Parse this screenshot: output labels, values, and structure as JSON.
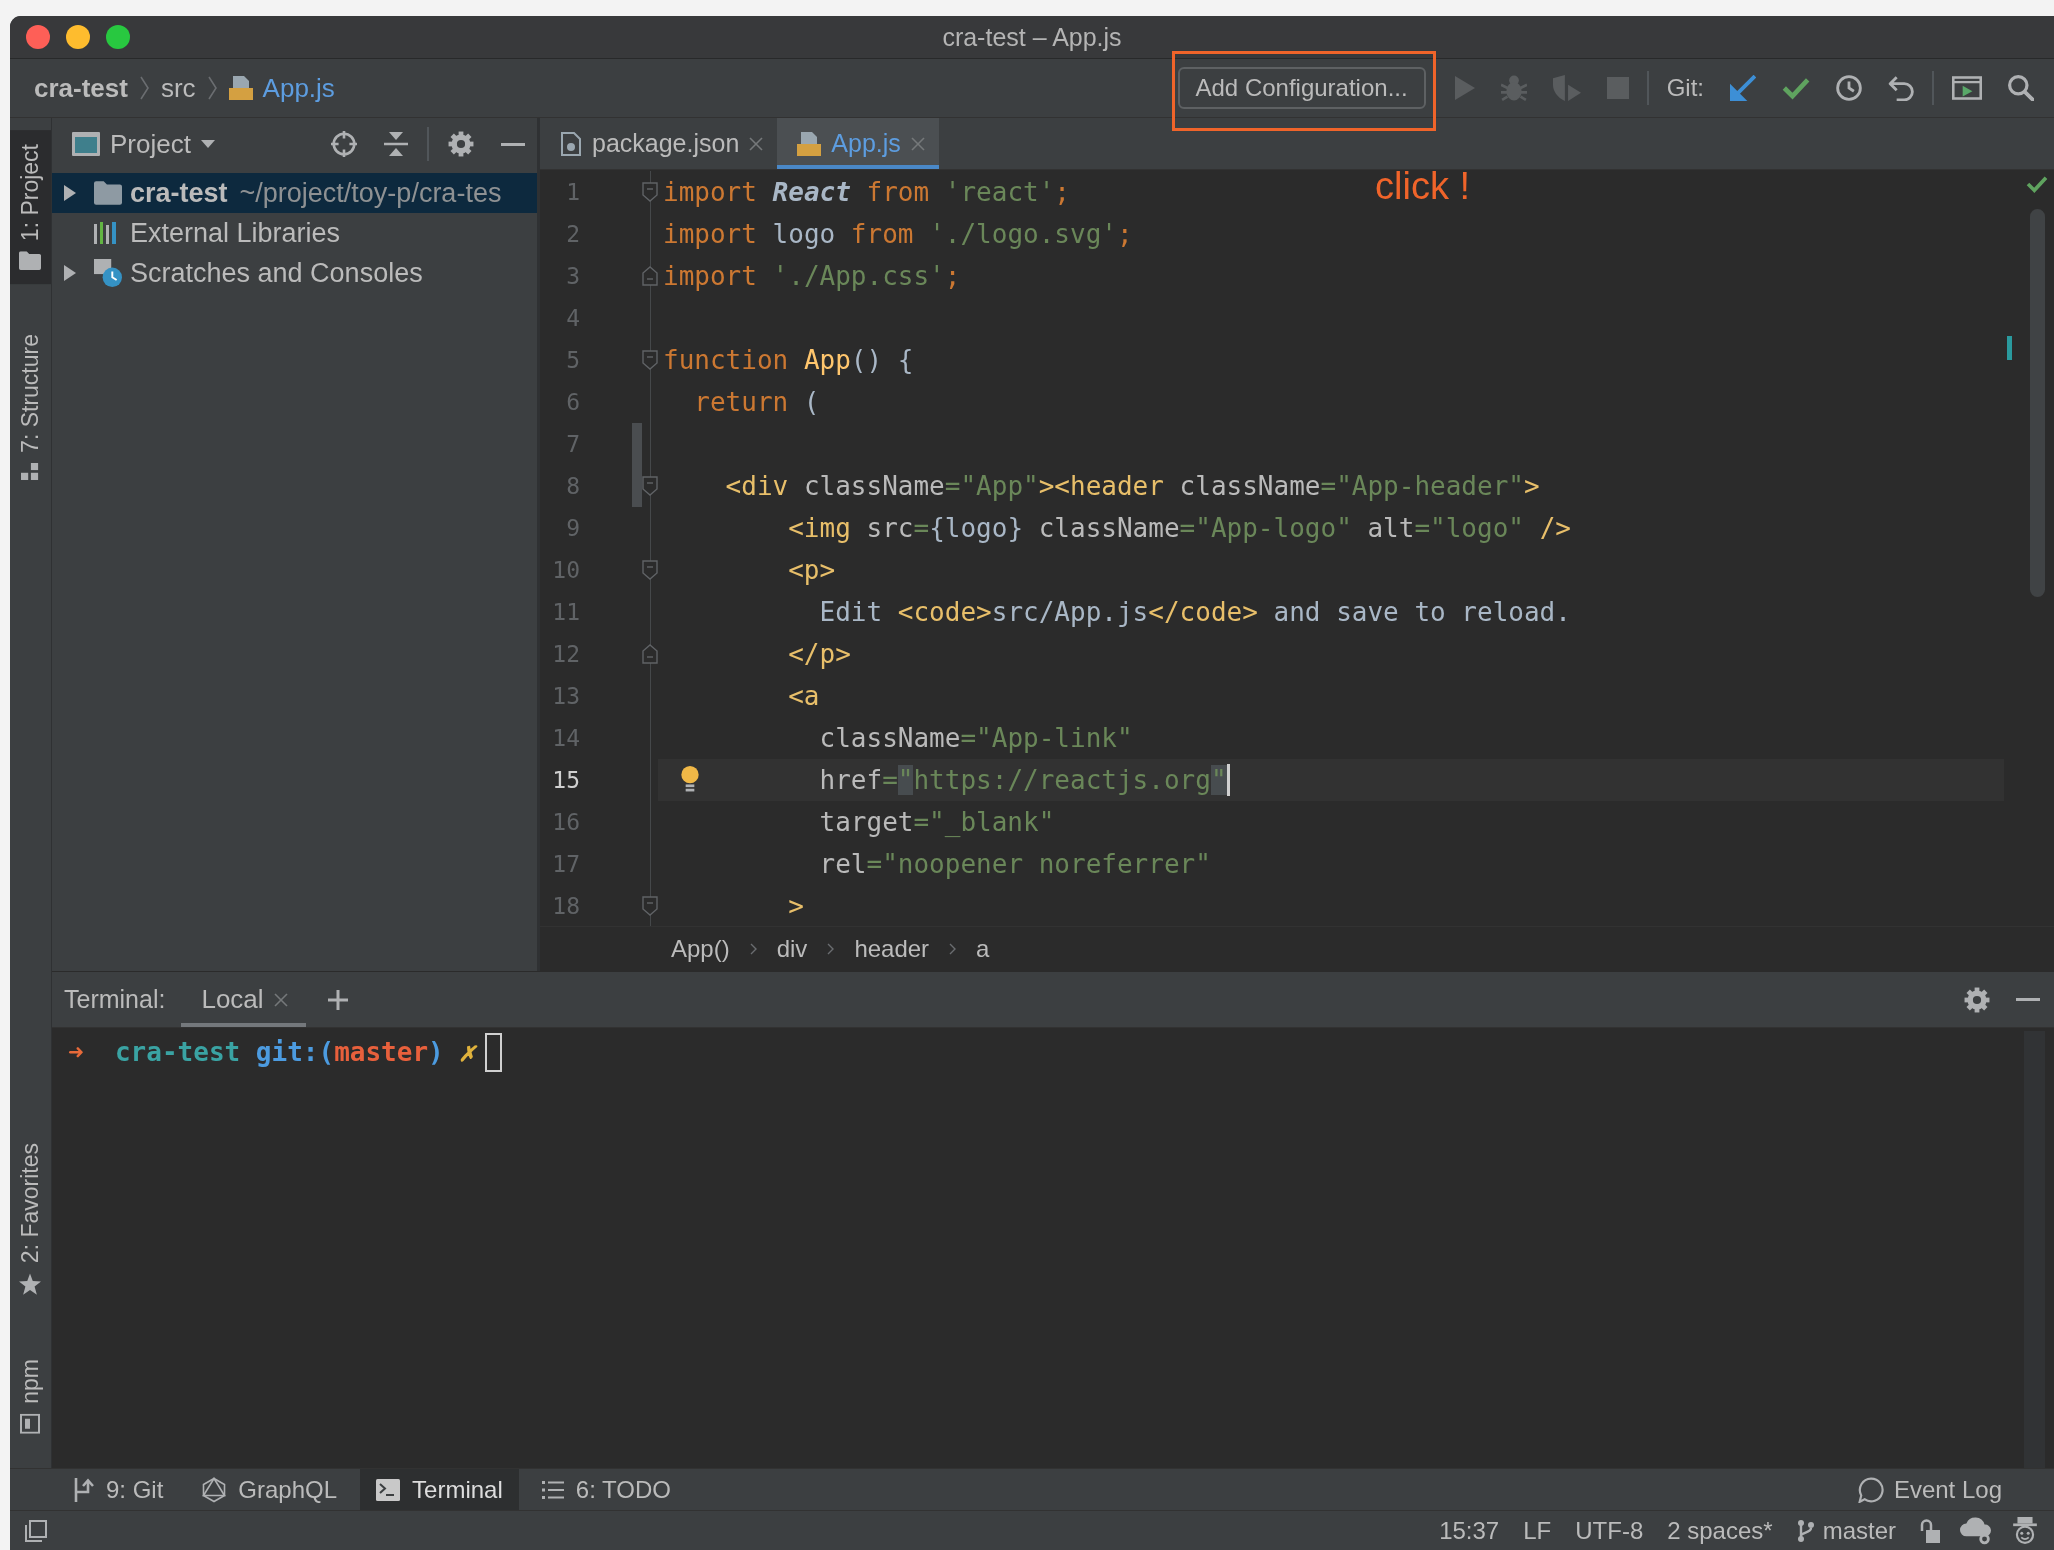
{
  "window": {
    "title": "cra-test – App.js"
  },
  "navbar": {
    "breadcrumbs": [
      {
        "label": "cra-test",
        "kind": "project",
        "modified": false
      },
      {
        "label": "src",
        "kind": "folder",
        "modified": false
      },
      {
        "label": "App.js",
        "kind": "file",
        "modified": true
      }
    ]
  },
  "toolbar": {
    "run_config": "Add Configuration...",
    "actions": [
      {
        "kind": "run",
        "disabled": true
      },
      {
        "kind": "debug",
        "disabled": true
      },
      {
        "kind": "coverage",
        "disabled": true
      },
      {
        "kind": "stop",
        "disabled": true
      }
    ],
    "git_label": "Git:"
  },
  "annotation": {
    "text": "click !"
  },
  "tool_stripe": {
    "top": [
      {
        "label": "1: Project",
        "kind": "project",
        "selected": true
      },
      {
        "label": "7: Structure",
        "kind": "structure",
        "selected": false
      }
    ],
    "bottom": [
      {
        "label": "2: Favorites",
        "kind": "favorites",
        "selected": false
      },
      {
        "label": "npm",
        "kind": "npm",
        "selected": false
      }
    ]
  },
  "project_panel": {
    "title": "Project",
    "tree": [
      {
        "label": "cra-test",
        "path": "~/project/toy-p/cra-tes",
        "kind": "module",
        "expanded": false,
        "selected": true
      },
      {
        "label": "External Libraries",
        "kind": "libraries",
        "selected": false
      },
      {
        "label": "Scratches and Consoles",
        "kind": "scratches",
        "expanded": false,
        "selected": false
      }
    ]
  },
  "editor": {
    "tabs": [
      {
        "label": "package.json",
        "kind": "json",
        "selected": false,
        "modified": false
      },
      {
        "label": "App.js",
        "kind": "js",
        "selected": true,
        "modified": true
      }
    ],
    "lines": [
      {
        "number": "1",
        "fold": {
          "kind": "start"
        },
        "changed": false,
        "current": false,
        "tokens": [
          {
            "kind": "keyword",
            "text": "import"
          },
          {
            "kind": "ident",
            "text": " React"
          },
          {
            "kind": "keyword",
            "text": " from"
          },
          {
            "kind": "string",
            "text": " 'react'"
          },
          {
            "kind": "keyword",
            "text": ";"
          }
        ]
      },
      {
        "number": "2",
        "changed": false,
        "current": false,
        "tokens": [
          {
            "kind": "keyword",
            "text": "import"
          },
          {
            "kind": "plain",
            "text": " logo"
          },
          {
            "kind": "keyword",
            "text": " from"
          },
          {
            "kind": "string",
            "text": " './logo.svg'"
          },
          {
            "kind": "keyword",
            "text": ";"
          }
        ]
      },
      {
        "number": "3",
        "fold": {
          "kind": "end"
        },
        "changed": false,
        "current": false,
        "tokens": [
          {
            "kind": "keyword",
            "text": "import"
          },
          {
            "kind": "string",
            "text": " './App.css'"
          },
          {
            "kind": "keyword",
            "text": ";"
          }
        ]
      },
      {
        "number": "4",
        "changed": false,
        "current": false
      },
      {
        "number": "5",
        "fold": {
          "kind": "start"
        },
        "changed": false,
        "current": false,
        "tokens": [
          {
            "kind": "keyword",
            "text": "function"
          },
          {
            "kind": "func",
            "text": " App"
          },
          {
            "kind": "plain",
            "text": "() {"
          }
        ]
      },
      {
        "number": "6",
        "changed": false,
        "current": false,
        "tokens": [
          {
            "kind": "keyword",
            "text": "  return"
          },
          {
            "kind": "plain",
            "text": " ("
          }
        ]
      },
      {
        "number": "7",
        "changed": true,
        "current": false
      },
      {
        "number": "8",
        "fold": {
          "kind": "start"
        },
        "changed": true,
        "current": false,
        "tokens": [
          {
            "kind": "tag",
            "text": "    <div"
          },
          {
            "kind": "attr",
            "text": " className"
          },
          {
            "kind": "string",
            "text": "=\"App\""
          },
          {
            "kind": "tag",
            "text": "><header"
          },
          {
            "kind": "attr",
            "text": " className"
          },
          {
            "kind": "string",
            "text": "=\"App-header\""
          },
          {
            "kind": "tag",
            "text": ">"
          }
        ]
      },
      {
        "number": "9",
        "changed": false,
        "current": false,
        "tokens": [
          {
            "kind": "tag",
            "text": "        <img"
          },
          {
            "kind": "attr",
            "text": " src"
          },
          {
            "kind": "string",
            "text": "="
          },
          {
            "kind": "plain",
            "text": "{logo}"
          },
          {
            "kind": "attr",
            "text": " className"
          },
          {
            "kind": "string",
            "text": "=\"App-logo\""
          },
          {
            "kind": "attr",
            "text": " alt"
          },
          {
            "kind": "string",
            "text": "=\"logo\""
          },
          {
            "kind": "tag",
            "text": " />"
          }
        ]
      },
      {
        "number": "10",
        "fold": {
          "kind": "start"
        },
        "changed": false,
        "current": false,
        "tokens": [
          {
            "kind": "tag",
            "text": "        <p>"
          }
        ]
      },
      {
        "number": "11",
        "changed": false,
        "current": false,
        "tokens": [
          {
            "kind": "plain",
            "text": "          Edit "
          },
          {
            "kind": "tag",
            "text": "<code>"
          },
          {
            "kind": "plain",
            "text": "src/App.js"
          },
          {
            "kind": "tag",
            "text": "</code>"
          },
          {
            "kind": "plain",
            "text": " and save to reload."
          }
        ]
      },
      {
        "number": "12",
        "fold": {
          "kind": "end"
        },
        "changed": false,
        "current": false,
        "tokens": [
          {
            "kind": "tag",
            "text": "        </p>"
          }
        ]
      },
      {
        "number": "13",
        "changed": false,
        "current": false,
        "tokens": [
          {
            "kind": "tag",
            "text": "        <a"
          }
        ]
      },
      {
        "number": "14",
        "changed": false,
        "current": false,
        "tokens": [
          {
            "kind": "attr",
            "text": "          className"
          },
          {
            "kind": "string",
            "text": "=\"App-link\""
          }
        ]
      },
      {
        "number": "15",
        "changed": false,
        "current": true,
        "tokens": [
          {
            "kind": "attr",
            "text": "          href"
          },
          {
            "kind": "string",
            "text": "="
          },
          {
            "kind": "match",
            "text": "\""
          },
          {
            "kind": "string",
            "text": "https://reactjs.org"
          },
          {
            "kind": "match",
            "text": "\""
          }
        ]
      },
      {
        "number": "16",
        "changed": false,
        "current": false,
        "tokens": [
          {
            "kind": "attr",
            "text": "          target"
          },
          {
            "kind": "string",
            "text": "=\"_blank\""
          }
        ]
      },
      {
        "number": "17",
        "changed": false,
        "current": false,
        "tokens": [
          {
            "kind": "attr",
            "text": "          rel"
          },
          {
            "kind": "string",
            "text": "=\"noopener noreferrer\""
          }
        ]
      },
      {
        "number": "18",
        "fold": {
          "kind": "start"
        },
        "changed": false,
        "current": false,
        "tokens": [
          {
            "kind": "tag",
            "text": "        >"
          }
        ]
      }
    ],
    "breadcrumbs": [
      "App()",
      "div",
      "header",
      "a"
    ]
  },
  "terminal": {
    "title": "Terminal:",
    "tabs": [
      {
        "label": "Local",
        "selected": true
      }
    ],
    "prompt": [
      {
        "kind": "arrow",
        "text": "➜"
      },
      {
        "kind": "dir",
        "text": "  cra-test"
      },
      {
        "kind": "git",
        "text": " git:("
      },
      {
        "kind": "branch",
        "text": "master"
      },
      {
        "kind": "git",
        "text": ")"
      },
      {
        "kind": "dirty",
        "text": " ✗"
      }
    ]
  },
  "bottom_bar": {
    "tools": [
      {
        "label": "9: Git",
        "kind": "git",
        "selected": false
      },
      {
        "label": "GraphQL",
        "kind": "graphql",
        "selected": false
      },
      {
        "label": "Terminal",
        "kind": "terminal",
        "selected": true
      },
      {
        "label": "6: TODO",
        "kind": "todo",
        "selected": false
      }
    ],
    "event_log": "Event Log"
  },
  "status_bar": {
    "items": [
      "15:37",
      "LF",
      "UTF-8",
      "2 spaces*"
    ],
    "branch": "master"
  }
}
